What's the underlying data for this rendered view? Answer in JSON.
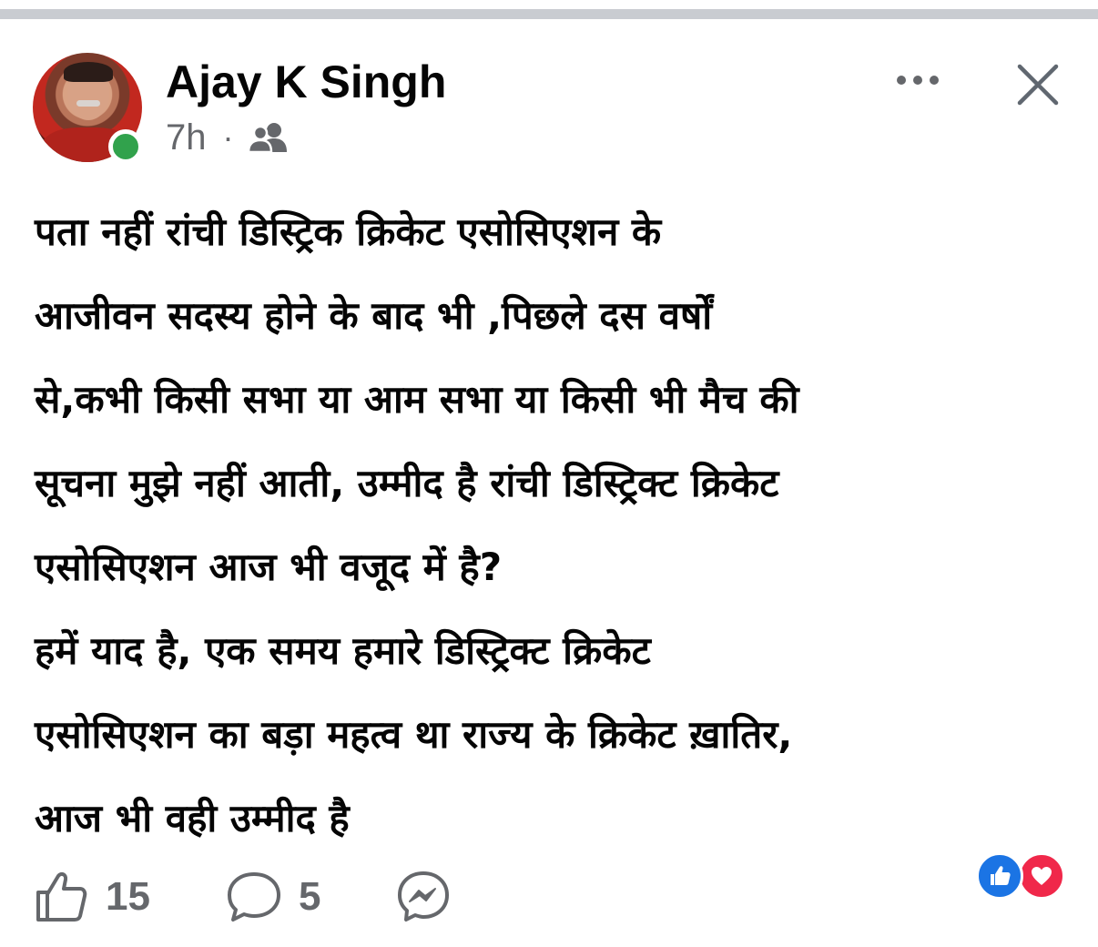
{
  "post": {
    "author": "Ajay K Singh",
    "time": "7h",
    "separator": "·",
    "audience_icon": "friends-icon",
    "body_lines": [
      "पता नहीं रांची डिस्ट्रिक क्रिकेट एसोसिएशन के",
      "आजीवन सदस्य होने के बाद भी ,पिछले दस वर्षों",
      "से,कभी किसी सभा या आम सभा या किसी भी मैच की",
      "सूचना मुझे नहीं आती, उम्मीद है रांची डिस्ट्रिक्ट क्रिकेट",
      "एसोसिएशन आज भी वजूद में है?",
      "हमें याद है, एक समय हमारे डिस्ट्रिक्ट क्रिकेट",
      "एसोसिएशन का बड़ा महत्व था राज्य के क्रिकेट ख़ातिर,",
      "आज भी वही  उम्मीद है"
    ]
  },
  "header_actions": {
    "more_icon": "more-horizontal-icon",
    "close_icon": "close-icon"
  },
  "footer": {
    "likes": "15",
    "comments": "5",
    "like_icon": "thumbs-up-icon",
    "comment_icon": "comment-icon",
    "share_icon": "messenger-icon",
    "reaction_icons": [
      "like-reaction-icon",
      "love-reaction-icon"
    ]
  },
  "colors": {
    "online": "#31a24c",
    "like_blue": "#1b74e4",
    "love_red": "#f0284a",
    "secondary_text": "#65676b",
    "divider": "#c9ccd1"
  }
}
